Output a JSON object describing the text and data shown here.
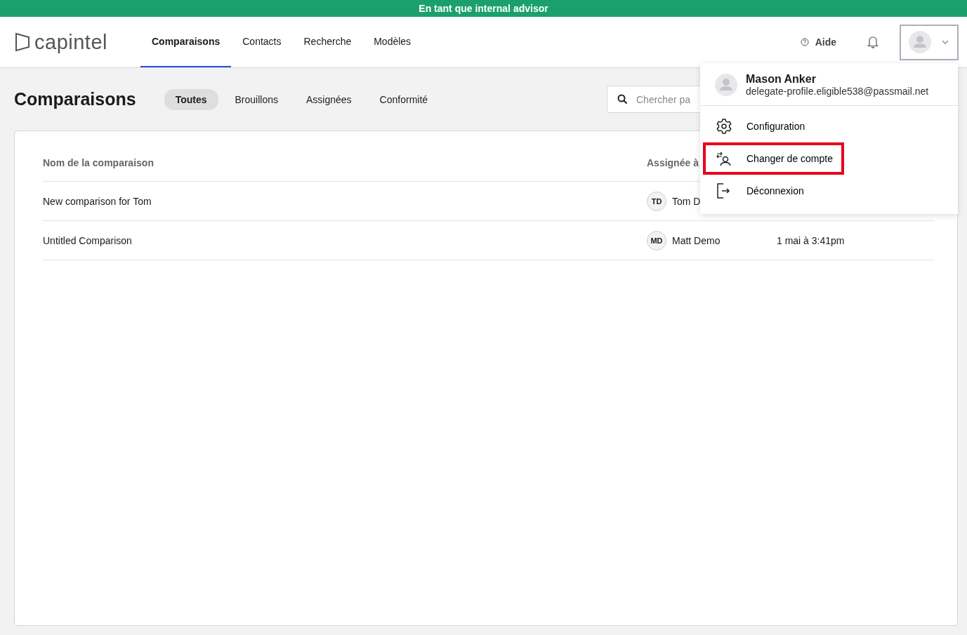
{
  "banner": "En tant que internal advisor",
  "logo": "capintel",
  "nav": [
    {
      "label": "Comparaisons",
      "selected": true
    },
    {
      "label": "Contacts",
      "selected": false
    },
    {
      "label": "Recherche",
      "selected": false
    },
    {
      "label": "Modèles",
      "selected": false
    }
  ],
  "help": "Aide",
  "page_title": "Comparaisons",
  "filters": [
    {
      "label": "Toutes",
      "selected": true
    },
    {
      "label": "Brouillons",
      "selected": false
    },
    {
      "label": "Assignées",
      "selected": false
    },
    {
      "label": "Conformité",
      "selected": false
    }
  ],
  "search": {
    "placeholder": "Chercher pa"
  },
  "table": {
    "columns": [
      "Nom de la comparaison",
      "Assignée à"
    ],
    "rows": [
      {
        "name": "New comparison for Tom",
        "initials": "TD",
        "assignee": "Tom D"
      },
      {
        "name": "Untitled Comparison",
        "initials": "MD",
        "assignee": "Matt Demo",
        "date": "1 mai à 3:41pm"
      }
    ]
  },
  "user_menu": {
    "name": "Mason Anker",
    "email": "delegate-profile.eligible538@passmail.net",
    "items": [
      {
        "kind": "settings",
        "label": "Configuration",
        "highlighted": false
      },
      {
        "kind": "switch",
        "label": "Changer de compte",
        "highlighted": true
      },
      {
        "kind": "logout",
        "label": "Déconnexion",
        "highlighted": false
      }
    ]
  }
}
